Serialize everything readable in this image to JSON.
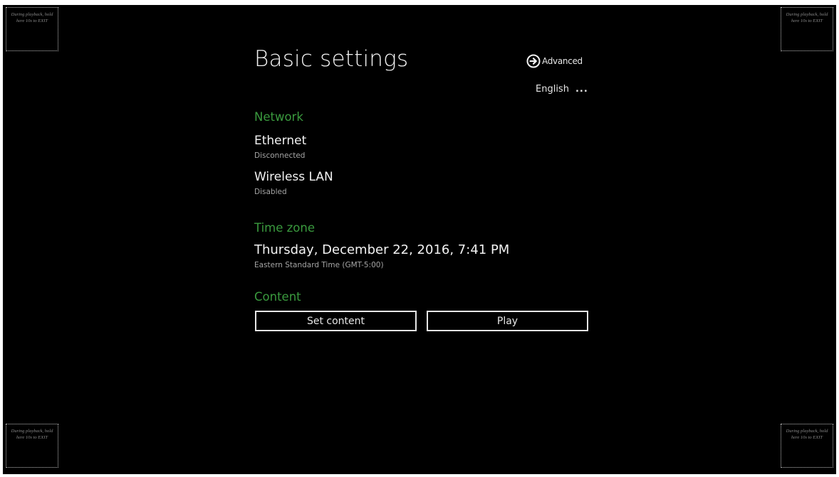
{
  "page_title": "Basic settings",
  "advanced": {
    "label": "Advanced",
    "icon": "arrow-circle-right-icon"
  },
  "language": {
    "label": "English",
    "more": "..."
  },
  "network": {
    "header": "Network",
    "ethernet": {
      "title": "Ethernet",
      "status": "Disconnected"
    },
    "wireless": {
      "title": "Wireless LAN",
      "status": "Disabled"
    }
  },
  "timezone": {
    "header": "Time zone",
    "datetime": "Thursday, December 22, 2016, 7:41 PM",
    "zone": "Eastern Standard Time (GMT-5:00)"
  },
  "content": {
    "header": "Content",
    "set_content_label": "Set content",
    "play_label": "Play"
  },
  "corner_hint": "During playback, hold here 10s to EXIT",
  "colors": {
    "background": "#000000",
    "accent_green": "#3a9a3e",
    "text": "#f2f2f2",
    "subtext": "#a5a5a5"
  }
}
